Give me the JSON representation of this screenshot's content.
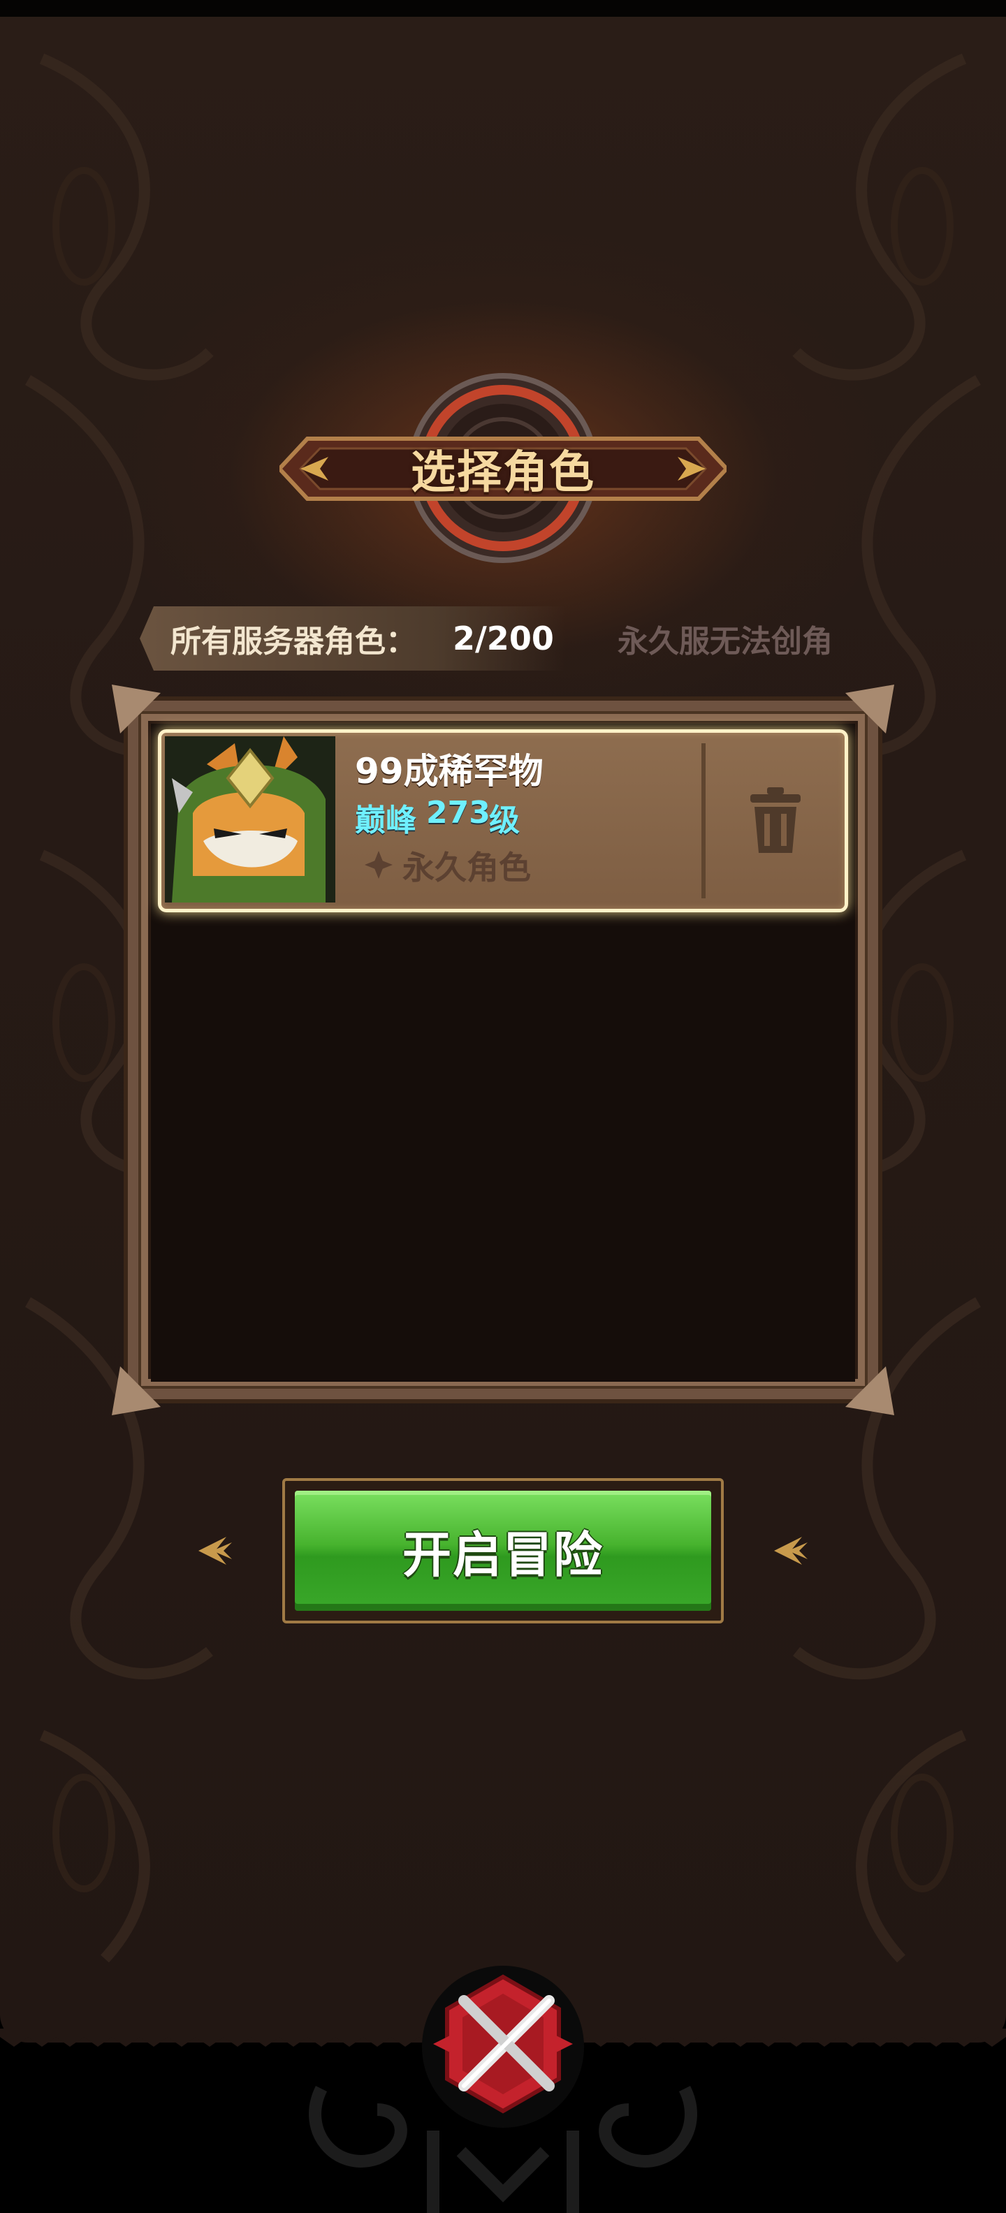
{
  "title": "选择角色",
  "server": {
    "label": "所有服务器角色：",
    "count": "2/200",
    "note": "永久服无法创角"
  },
  "characters": [
    {
      "name": "99成稀罕物",
      "level_prefix": "巅峰",
      "level": "273",
      "level_unit": "级",
      "tag": "永久角色"
    }
  ],
  "icons": {
    "delete": "trash-icon",
    "permanent": "diamond-icon",
    "close": "close-x-icon"
  },
  "start_button": "开启冒险",
  "colors": {
    "accent_green": "#47b32e",
    "level_cyan": "#6ff0ff",
    "title_gold": "#f6d9a0",
    "card_brown": "#8e6d4f"
  }
}
